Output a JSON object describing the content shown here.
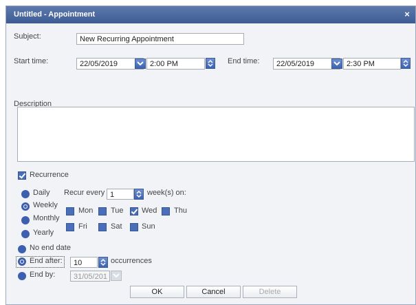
{
  "window": {
    "title": "Untitled - Appointment",
    "close_symbol": "×"
  },
  "subject": {
    "label": "Subject:",
    "value": "New Recurring Appointment"
  },
  "start": {
    "label": "Start time:",
    "date": "22/05/2019",
    "time": "2:00 PM"
  },
  "end": {
    "label": "End time:",
    "date": "22/05/2019",
    "time": "2:30 PM"
  },
  "description": {
    "label": "Description",
    "value": ""
  },
  "recurrence": {
    "label": "Recurrence",
    "checked": true
  },
  "pattern": {
    "options": [
      "Daily",
      "Weekly",
      "Monthly",
      "Yearly"
    ],
    "selected": "Weekly"
  },
  "recur_every": {
    "label": "Recur every",
    "value": "1",
    "suffix": "week(s) on:"
  },
  "days": [
    {
      "label": "Mon",
      "checked": false
    },
    {
      "label": "Tue",
      "checked": false
    },
    {
      "label": "Wed",
      "checked": true
    },
    {
      "label": "Thu",
      "checked": false
    },
    {
      "label": "Fri",
      "checked": false
    },
    {
      "label": "Sat",
      "checked": false
    },
    {
      "label": "Sun",
      "checked": false
    }
  ],
  "range": {
    "no_end": "No end date",
    "end_after": {
      "label": "End after:",
      "value": "10",
      "suffix": "occurrences"
    },
    "end_by": {
      "label": "End by:",
      "value": "31/05/201"
    },
    "selected": "End after:"
  },
  "buttons": {
    "ok": "OK",
    "cancel": "Cancel",
    "delete": "Delete"
  },
  "colors": {
    "title_bar": "#3d5b93",
    "accent": "#3d63b2",
    "window_bg": "#f1f3f7"
  }
}
